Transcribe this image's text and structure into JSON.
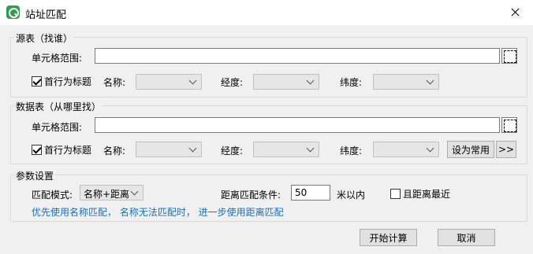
{
  "window": {
    "title": "站址匹配",
    "close_label": "✕"
  },
  "source": {
    "group_title": "源表（找谁）",
    "cell_range_label": "单元格范围:",
    "cell_range_value": "",
    "first_row_header_label": "首行为标题",
    "name_label": "名称:",
    "lng_label": "经度:",
    "lat_label": "纬度:"
  },
  "data": {
    "group_title": "数据表（从哪里找）",
    "cell_range_label": "单元格范围:",
    "cell_range_value": "",
    "first_row_header_label": "首行为标题",
    "name_label": "名称:",
    "lng_label": "经度:",
    "lat_label": "纬度:",
    "set_common_label": "设为常用",
    "more_label": ">>"
  },
  "params": {
    "group_title": "参数设置",
    "match_mode_label": "匹配模式:",
    "match_mode_value": "名称+距离",
    "distance_condition_label": "距离匹配条件:",
    "distance_value": "50",
    "distance_unit": "米以内",
    "nearest_label": "且距离最近",
    "hint": "优先使用名称匹配，  名称无法匹配时，  进一步使用距离匹配"
  },
  "footer": {
    "start_label": "开始计算",
    "cancel_label": "取消"
  }
}
